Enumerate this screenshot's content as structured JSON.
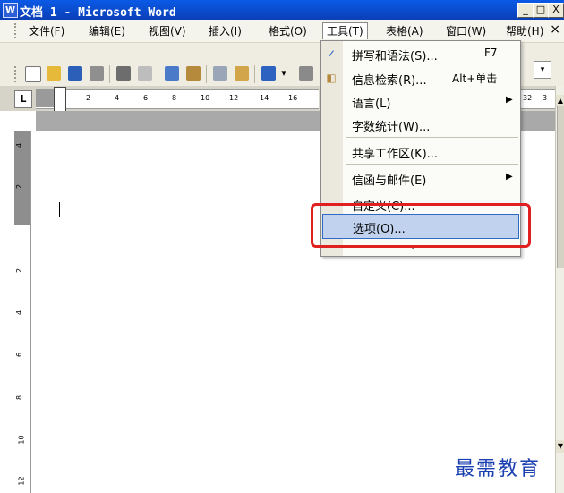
{
  "window": {
    "title": "文档 1 - Microsoft Word",
    "app_icon": "W",
    "buttons": {
      "minimize": "_",
      "maximize": "□",
      "close": "X"
    }
  },
  "menubar": {
    "items": [
      {
        "label": "文件(F)"
      },
      {
        "label": "编辑(E)"
      },
      {
        "label": "视图(V)"
      },
      {
        "label": "插入(I)"
      },
      {
        "label": "格式(O)"
      },
      {
        "label": "工具(T)"
      },
      {
        "label": "表格(A)"
      },
      {
        "label": "窗口(W)"
      },
      {
        "label": "帮助(H)"
      }
    ],
    "active_index": 5,
    "close_doc": "×"
  },
  "ruler": {
    "corner": "L",
    "ticks": [
      "2",
      "4",
      "6",
      "8",
      "10",
      "12",
      "14",
      "16"
    ],
    "right_ticks": [
      "32",
      "3"
    ],
    "vertical_ticks": [
      "4",
      "2",
      "2",
      "4",
      "6",
      "8",
      "10",
      "12"
    ]
  },
  "tools_menu": {
    "items": [
      {
        "label": "拼写和语法(S)...",
        "shortcut": "F7",
        "icon": "spell-check-icon"
      },
      {
        "label": "信息检索(R)...",
        "shortcut": "Alt+单击",
        "icon": "research-icon"
      },
      {
        "label": "语言(L)",
        "submenu": true
      },
      {
        "label": "字数统计(W)..."
      },
      {
        "label": "共享工作区(K)..."
      },
      {
        "label": "信函与邮件(E)",
        "submenu": true
      },
      {
        "label": "自定义(C)..."
      },
      {
        "label": "选项(O)..."
      }
    ],
    "selected_index": 7,
    "more_glyph": "⌄"
  },
  "watermark": "最需教育",
  "colors": {
    "titlebar": "#0b4bd0",
    "highlight": "#e02020",
    "selection": "#c1d2ee"
  }
}
